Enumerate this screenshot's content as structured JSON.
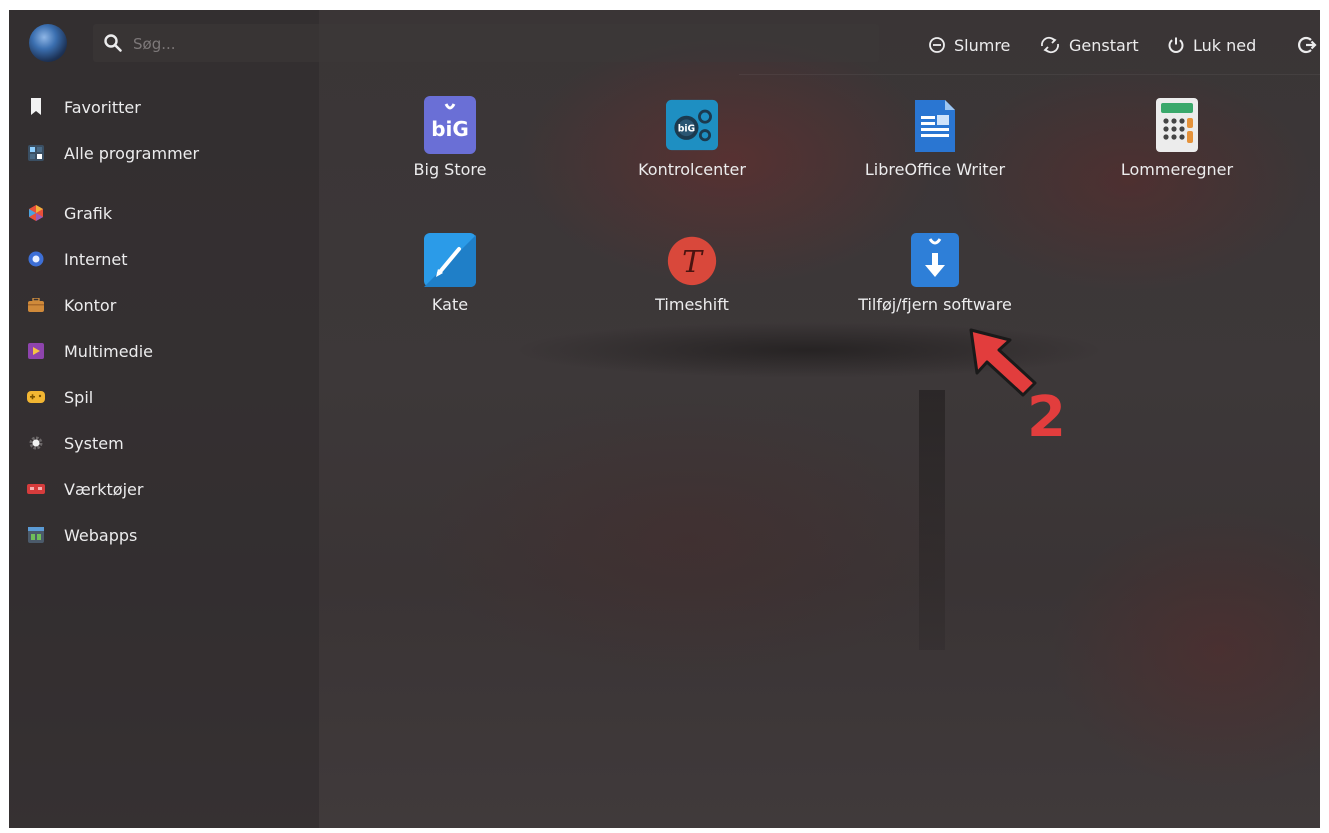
{
  "search": {
    "placeholder": "Søg..."
  },
  "power": {
    "sleep_label": "Slumre",
    "restart_label": "Genstart",
    "shutdown_label": "Luk ned"
  },
  "sidebar": {
    "items": [
      {
        "label": "Favoritter",
        "icon": "bookmark-icon"
      },
      {
        "label": "Alle programmer",
        "icon": "all-apps-icon"
      },
      {
        "label": "Grafik",
        "icon": "graphics-icon"
      },
      {
        "label": "Internet",
        "icon": "internet-icon"
      },
      {
        "label": "Kontor",
        "icon": "office-icon"
      },
      {
        "label": "Multimedie",
        "icon": "multimedia-icon"
      },
      {
        "label": "Spil",
        "icon": "games-icon"
      },
      {
        "label": "System",
        "icon": "system-icon"
      },
      {
        "label": "Værktøjer",
        "icon": "tools-icon"
      },
      {
        "label": "Webapps",
        "icon": "webapps-icon"
      }
    ]
  },
  "apps": [
    {
      "label": "Big Store",
      "icon": "big-store-icon"
    },
    {
      "label": "Kontrolcenter",
      "icon": "control-center-icon"
    },
    {
      "label": "LibreOffice Writer",
      "icon": "libreoffice-writer-icon"
    },
    {
      "label": "Lommeregner",
      "icon": "calculator-icon"
    },
    {
      "label": "Kate",
      "icon": "kate-icon"
    },
    {
      "label": "Timeshift",
      "icon": "timeshift-icon"
    },
    {
      "label": "Tilføj/fjern software",
      "icon": "add-remove-software-icon"
    }
  ],
  "annotation": {
    "number": "2",
    "color": "#e23d3d"
  },
  "colors": {
    "accent": "#e23d3d",
    "text": "#ececed"
  }
}
